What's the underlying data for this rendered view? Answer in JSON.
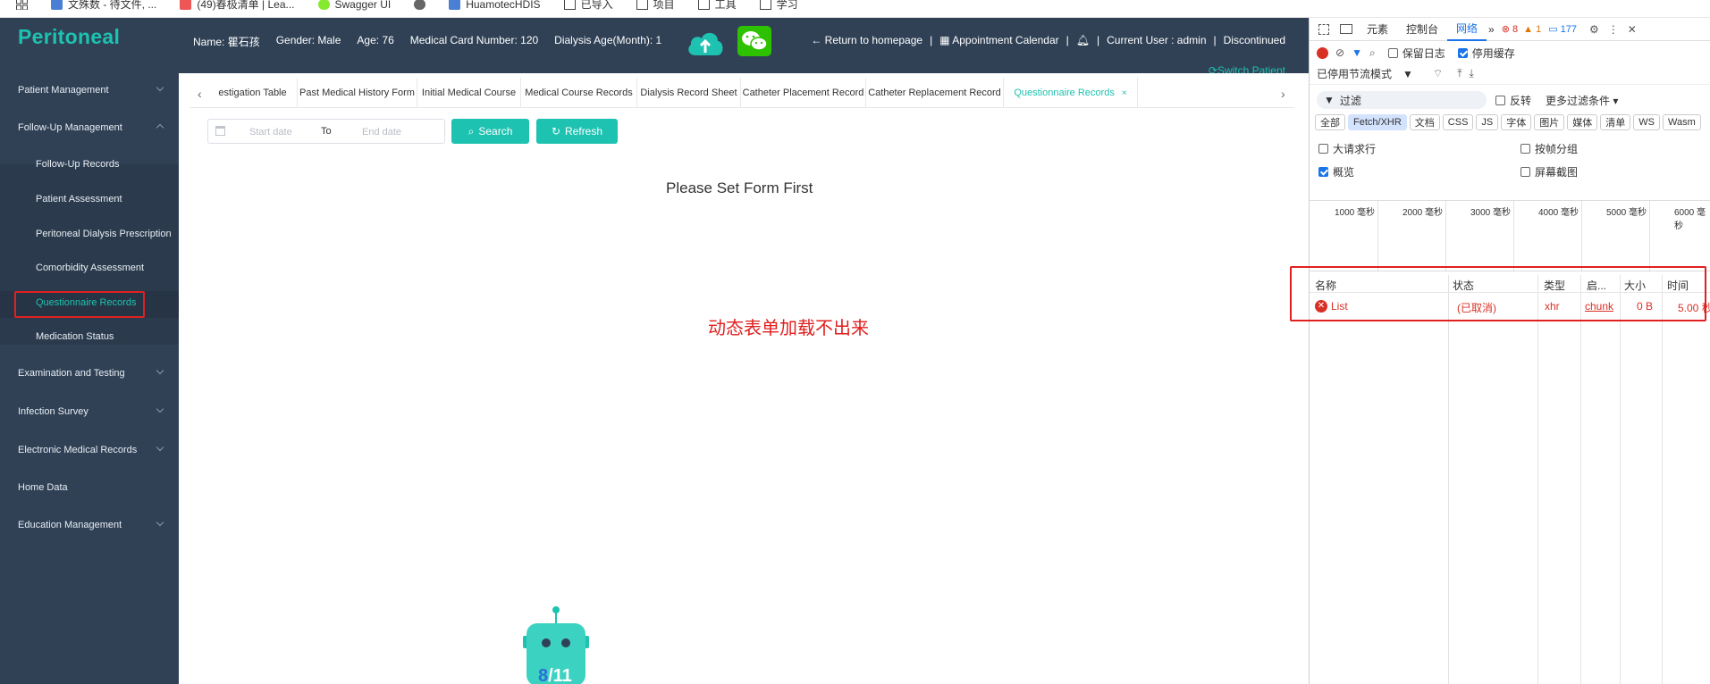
{
  "bookmarks": [
    {
      "label": "文殊数 - 待文件, ...",
      "icon": "x-icon",
      "color": "#4a7fd6"
    },
    {
      "label": "(49)春极清单 | Lea...",
      "icon": "leetcode-icon",
      "color": "#e55"
    },
    {
      "label": "Swagger UI",
      "icon": "swagger-icon",
      "color": "#85ea2d"
    },
    {
      "label": "",
      "icon": "chrome-icon",
      "color": "#666"
    },
    {
      "label": "HuamotecHDIS",
      "icon": "hdis-icon",
      "color": "#4a7fd6"
    },
    {
      "label": "已导入",
      "icon": "folder-icon",
      "color": "#444"
    },
    {
      "label": "项目",
      "icon": "folder-icon",
      "color": "#444"
    },
    {
      "label": "工具",
      "icon": "folder-icon",
      "color": "#444"
    },
    {
      "label": "学习",
      "icon": "folder-icon",
      "color": "#444"
    }
  ],
  "app": {
    "logo": "Peritoneal",
    "patient": {
      "name": "Name: 瞿石孩",
      "gender": "Gender: Male",
      "age": "Age: 76",
      "card": "Medical Card Number: 120",
      "dialysis_age": "Dialysis Age(Month): 1"
    },
    "top_actions": {
      "home": "← Return to homepage",
      "sep1": "|",
      "calendar": "Appointment Calendar",
      "sep2": "|",
      "sep3": "|",
      "user": "Current User : admin",
      "sep4": "|",
      "discontinued": "Discontinued",
      "switch_patient": "Switch Patient"
    },
    "sidebar": {
      "items": [
        {
          "label": "Patient Management",
          "chevron": "down"
        },
        {
          "label": "Follow-Up Management",
          "chevron": "up"
        },
        {
          "label": "Follow-Up Records",
          "sub": true
        },
        {
          "label": "Patient Assessment",
          "sub": true
        },
        {
          "label": "Peritoneal Dialysis Prescription",
          "sub": true
        },
        {
          "label": "Comorbidity Assessment",
          "sub": true
        },
        {
          "label": "Questionnaire Records",
          "sub": true,
          "active": true
        },
        {
          "label": "Medication Status",
          "sub": true
        },
        {
          "label": "Examination and Testing",
          "chevron": "down"
        },
        {
          "label": "Infection Survey",
          "chevron": "down"
        },
        {
          "label": "Electronic Medical Records",
          "chevron": "down"
        },
        {
          "label": "Home Data"
        },
        {
          "label": "Education Management",
          "chevron": "down"
        }
      ]
    },
    "tabs": [
      "estigation Table",
      "Past Medical History Form",
      "Initial Medical Course",
      "Medical Course Records",
      "Dialysis Record Sheet",
      "Catheter Placement Record",
      "Catheter Replacement Record",
      "Questionnaire Records"
    ],
    "active_tab": "Questionnaire Records",
    "filter": {
      "start_placeholder": "Start date",
      "to": "To",
      "end_placeholder": "End date",
      "search": "Search",
      "refresh": "Refresh"
    },
    "empty_message": "Please Set Form First",
    "annotation": "动态表单加载不出来",
    "robot_badge": {
      "current": "8",
      "sep": "/",
      "total": "11"
    }
  },
  "devtools": {
    "tabs": [
      "元素",
      "控制台",
      "网络"
    ],
    "active_tab": "网络",
    "errors": "8",
    "warnings": "1",
    "messages": "177",
    "toolbar": {
      "preserve_log": "保留日志",
      "disable_cache": "停用缓存",
      "throttle": "已停用节流模式"
    },
    "filter": {
      "placeholder": "过滤",
      "invert": "反转",
      "more": "更多过滤条件"
    },
    "types": [
      "全部",
      "Fetch/XHR",
      "文档",
      "CSS",
      "JS",
      "字体",
      "图片",
      "媒体",
      "清单",
      "WS",
      "Wasm"
    ],
    "active_type": "Fetch/XHR",
    "options": {
      "large_rows": "大请求行",
      "group_by_frame": "按帧分组",
      "overview": "概览",
      "screenshots": "屏幕截图"
    },
    "timeline_ticks": [
      "1000 毫秒",
      "2000 毫秒",
      "3000 毫秒",
      "4000 毫秒",
      "5000 毫秒",
      "6000 毫秒"
    ],
    "columns": [
      "名称",
      "状态",
      "类型",
      "启...",
      "大小",
      "时间"
    ],
    "requests": [
      {
        "name": "List",
        "status": "(已取消)",
        "type": "xhr",
        "initiator": "chunk",
        "size": "0 B",
        "time": "5.00 秒"
      }
    ]
  }
}
